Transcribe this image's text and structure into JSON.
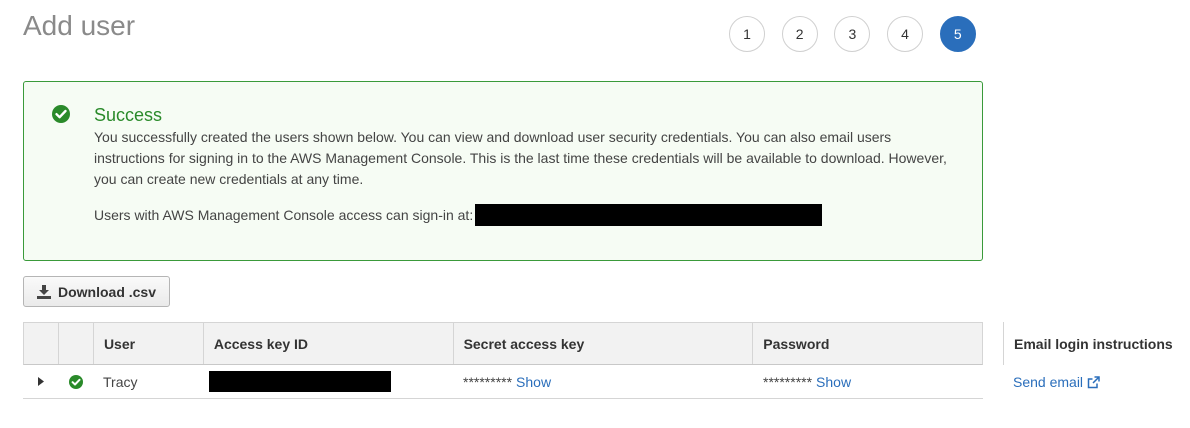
{
  "header": {
    "title": "Add user"
  },
  "steps": [
    {
      "label": "1",
      "active": false
    },
    {
      "label": "2",
      "active": false
    },
    {
      "label": "3",
      "active": false
    },
    {
      "label": "4",
      "active": false
    },
    {
      "label": "5",
      "active": true
    }
  ],
  "alert": {
    "title": "Success",
    "body": "You successfully created the users shown below. You can view and download user security credentials. You can also email users instructions for signing in to the AWS Management Console. This is the last time these credentials will be available to download. However, you can create new credentials at any time.",
    "signin_label": "Users with AWS Management Console access can sign-in at:"
  },
  "toolbar": {
    "download_label": "Download .csv"
  },
  "table": {
    "columns": [
      "",
      "",
      "User",
      "Access key ID",
      "Secret access key",
      "Password"
    ],
    "rows": [
      {
        "user": "Tracy",
        "secret_mask": "*********",
        "secret_show": "Show",
        "password_mask": "*********",
        "password_show": "Show"
      }
    ]
  },
  "email": {
    "header": "Email login instructions",
    "send_label": "Send email"
  },
  "colors": {
    "accent": "#2a6ebb",
    "success": "#2a8a2a",
    "success_bg": "#f6fcf4",
    "success_border": "#3a9a3a"
  }
}
